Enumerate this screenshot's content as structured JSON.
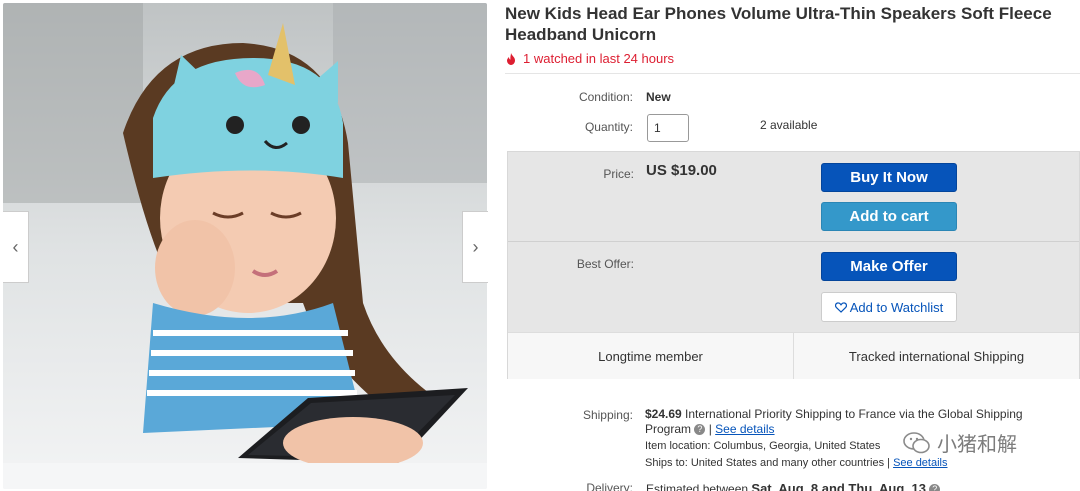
{
  "product": {
    "title": "New Kids Head Ear Phones Volume Ultra-Thin Speakers Soft Fleece Headband Unicorn",
    "watch_text": "1 watched in last 24 hours"
  },
  "details": {
    "condition_label": "Condition:",
    "condition_value": "New",
    "quantity_label": "Quantity:",
    "quantity_value": "1",
    "available_text": "2 available"
  },
  "purchase": {
    "price_label": "Price:",
    "price_value": "US $19.00",
    "buy_now_label": "Buy It Now",
    "add_to_cart_label": "Add to cart",
    "best_offer_label": "Best Offer:",
    "make_offer_label": "Make Offer",
    "watchlist_label": "Add to Watchlist",
    "feature_left": "Longtime member",
    "feature_right": "Tracked international Shipping"
  },
  "shipping": {
    "label": "Shipping:",
    "cost": "$24.69",
    "method": "International Priority Shipping to France  via the Global Shipping",
    "method_cont": "Program",
    "see_details": "See details",
    "location": "Item location:  Columbus, Georgia, United States",
    "ships_to": "Ships to:  United States and many other countries |",
    "see_details_2": "See details"
  },
  "delivery": {
    "label": "Delivery:",
    "text_prefix": "Estimated between",
    "dates": "Sat. Aug. 8 and Thu. Aug. 13"
  },
  "watermark": {
    "text": "小猪和解"
  },
  "colors": {
    "buy_blue": "#0654ba",
    "cart_blue": "#3498ca",
    "alert_red": "#dd1e31"
  }
}
